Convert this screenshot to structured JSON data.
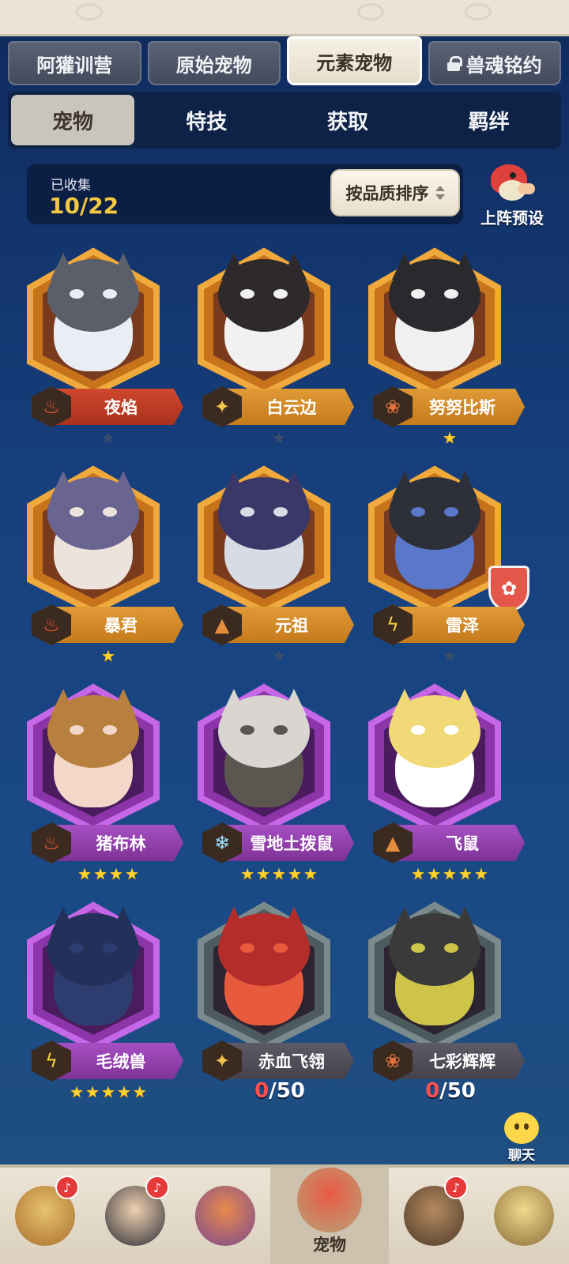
{
  "main_tabs": [
    {
      "label": "阿獾训营",
      "active": false,
      "locked": false
    },
    {
      "label": "原始宠物",
      "active": false,
      "locked": false
    },
    {
      "label": "元素宠物",
      "active": true,
      "locked": false
    },
    {
      "label": "兽魂铭约",
      "active": false,
      "locked": true
    }
  ],
  "sub_tabs": [
    {
      "label": "宠物",
      "active": true
    },
    {
      "label": "特技",
      "active": false
    },
    {
      "label": "获取",
      "active": false
    },
    {
      "label": "羁绊",
      "active": false
    }
  ],
  "collection": {
    "label": "已收集",
    "value": "10/22"
  },
  "sort_button": {
    "label": "按品质排序",
    "icon": "sort-icon"
  },
  "preset_button": {
    "label": "上阵预设"
  },
  "pets": [
    {
      "name": "夜焰",
      "element": "fire",
      "frame": "orange",
      "plate": "red",
      "stars": 1,
      "stars_lit": 0
    },
    {
      "name": "白云边",
      "element": "light",
      "frame": "orange",
      "plate": "orange",
      "stars": 1,
      "stars_lit": 0
    },
    {
      "name": "努努比斯",
      "element": "paw",
      "frame": "orange",
      "plate": "orange",
      "stars": 1,
      "stars_lit": 1
    },
    {
      "name": "暴君",
      "element": "fire",
      "frame": "orange",
      "plate": "orange",
      "stars": 1,
      "stars_lit": 1
    },
    {
      "name": "元祖",
      "element": "earth",
      "frame": "orange",
      "plate": "orange",
      "stars": 1,
      "stars_lit": 0
    },
    {
      "name": "雷泽",
      "element": "thunder",
      "frame": "orange",
      "plate": "orange",
      "stars": 1,
      "stars_lit": 0,
      "badge": "paw-shield-icon"
    },
    {
      "name": "猪布林",
      "element": "fire",
      "frame": "purple",
      "plate": "purple",
      "stars": 4,
      "stars_lit": 4
    },
    {
      "name": "雪地土拨鼠",
      "element": "ice",
      "frame": "purple",
      "plate": "purple",
      "stars": 5,
      "stars_lit": 5
    },
    {
      "name": "飞鼠",
      "element": "earth",
      "frame": "purple",
      "plate": "purple",
      "stars": 5,
      "stars_lit": 5
    },
    {
      "name": "毛绒兽",
      "element": "thunder",
      "frame": "purple",
      "plate": "purple",
      "stars": 5,
      "stars_lit": 5
    },
    {
      "name": "赤血飞翎",
      "element": "light",
      "frame": "gray",
      "plate": "gray",
      "progress_current": "0",
      "progress_total": "/50"
    },
    {
      "name": "七彩辉辉",
      "element": "paw",
      "frame": "gray",
      "plate": "gray",
      "progress_current": "0",
      "progress_total": "/50"
    }
  ],
  "chat": {
    "label": "聊天"
  },
  "bottom_nav": [
    {
      "icon": "tribe-icon",
      "label": "",
      "notify": true
    },
    {
      "icon": "character-icon",
      "label": "",
      "notify": true
    },
    {
      "icon": "totem-icon",
      "label": "",
      "notify": false
    },
    {
      "icon": "pet-icon",
      "label": "宠物",
      "notify": false,
      "active": true
    },
    {
      "icon": "raccoon-icon",
      "label": "",
      "notify": true
    },
    {
      "icon": "shop-icon",
      "label": "",
      "notify": false
    }
  ],
  "colors": {
    "frame_orange": "#e39a32",
    "frame_purple": "#b152d6",
    "frame_gray": "#5e6b6e",
    "star_lit": "#ffd22e",
    "collected_value": "#f5c842"
  }
}
